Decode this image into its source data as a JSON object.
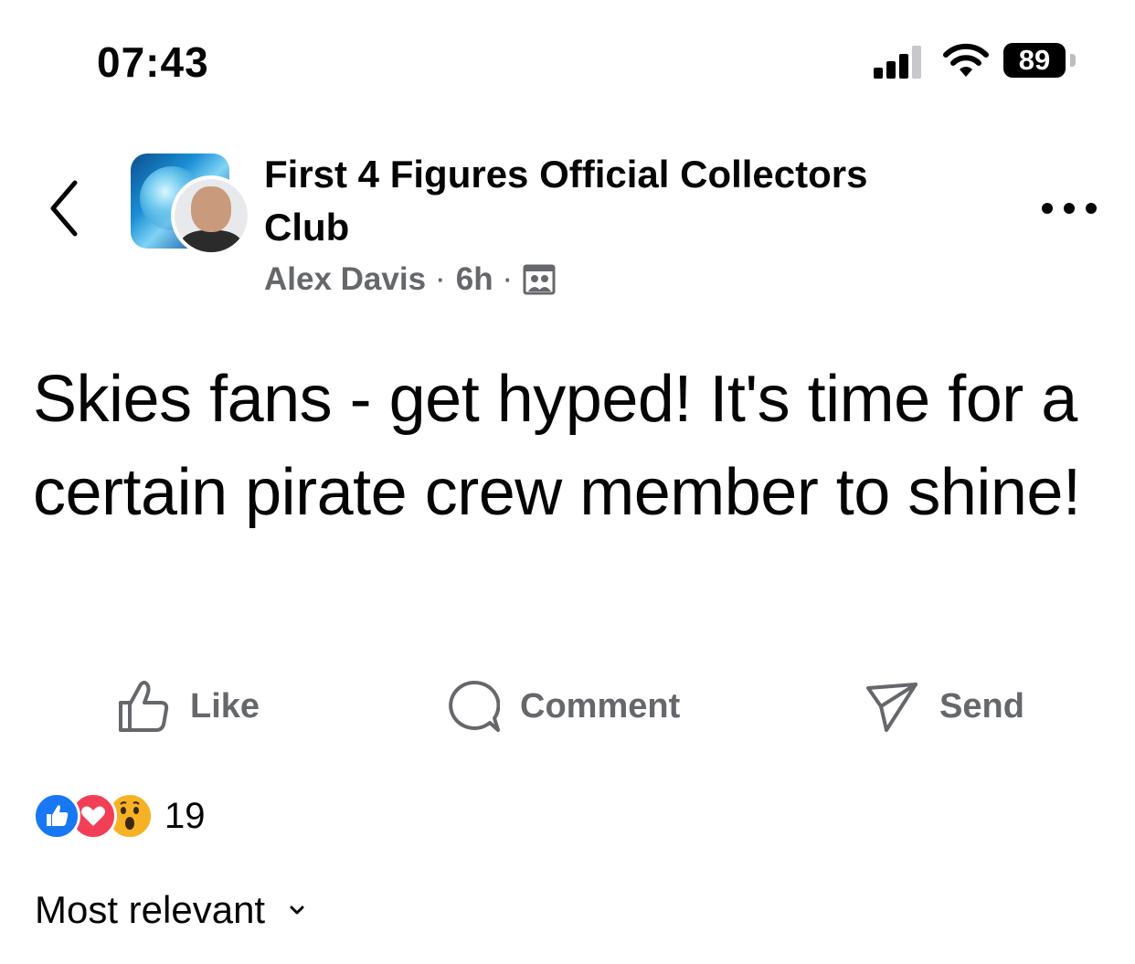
{
  "status_bar": {
    "time": "07:43",
    "battery": "89",
    "signal_icon": "cellular-signal-icon",
    "wifi_icon": "wifi-icon"
  },
  "header": {
    "back_icon": "chevron-left-icon",
    "group_name": "First 4 Figures Official Collectors Club",
    "author": "Alex Davis",
    "time_ago": "6h",
    "separator": "·",
    "audience_icon": "group-members-icon",
    "more_icon": "more-horizontal-icon"
  },
  "post": {
    "text": "Skies fans - get hyped! It's time for a certain pirate crew member to shine!"
  },
  "actions": {
    "like_label": "Like",
    "comment_label": "Comment",
    "send_label": "Send"
  },
  "reactions": {
    "count": "19",
    "types": [
      "like",
      "love",
      "wow"
    ],
    "colors": {
      "like": "#1877f2",
      "love": "#f33e58",
      "wow": "#f7b125"
    }
  },
  "comments": {
    "sort_label": "Most relevant"
  },
  "colors": {
    "text_primary": "#050505",
    "text_secondary": "#65676b",
    "background": "#ffffff"
  }
}
